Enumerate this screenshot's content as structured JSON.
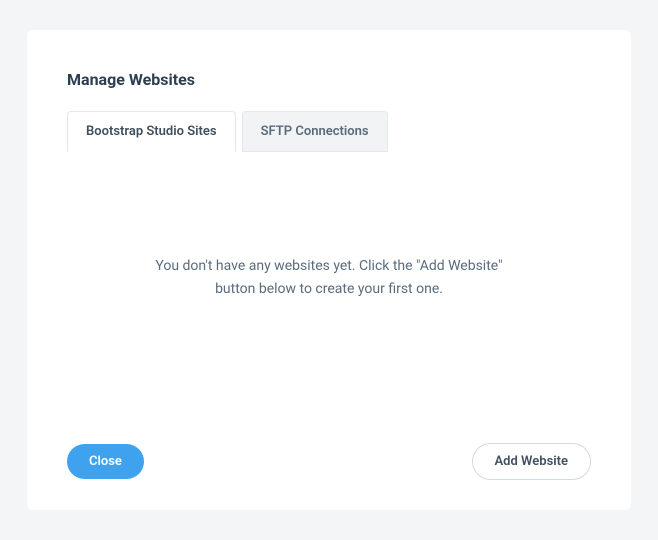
{
  "title": "Manage Websites",
  "tabs": {
    "active": "Bootstrap Studio Sites",
    "inactive": "SFTP Connections"
  },
  "empty_message": "You don't have any websites yet. Click the \"Add Website\" button below to create your first one.",
  "buttons": {
    "close": "Close",
    "add": "Add Website"
  }
}
